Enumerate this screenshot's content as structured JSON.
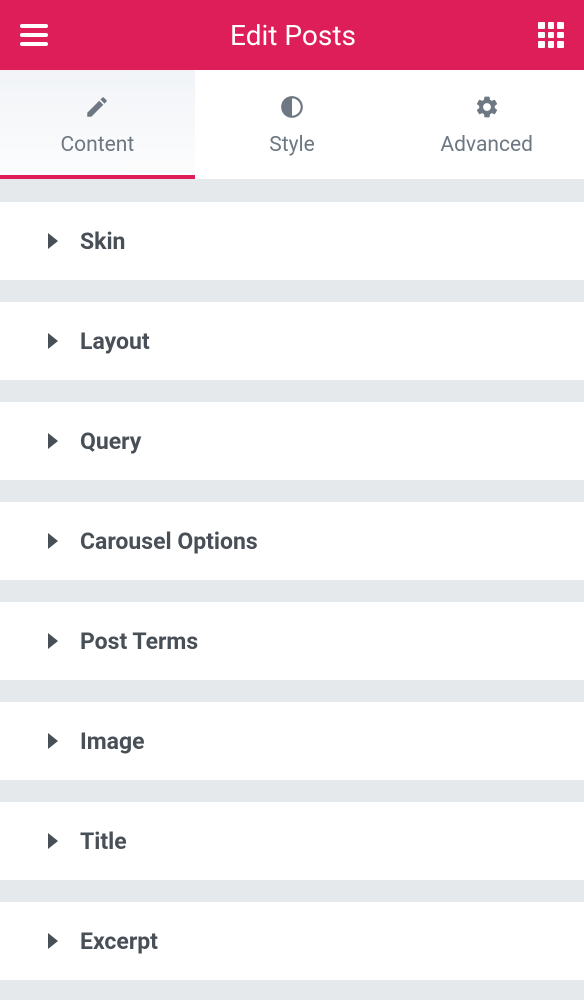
{
  "header": {
    "title": "Edit Posts"
  },
  "tabs": [
    {
      "label": "Content",
      "active": true,
      "icon": "pencil-icon"
    },
    {
      "label": "Style",
      "active": false,
      "icon": "contrast-icon"
    },
    {
      "label": "Advanced",
      "active": false,
      "icon": "gear-icon"
    }
  ],
  "sections": [
    {
      "title": "Skin"
    },
    {
      "title": "Layout"
    },
    {
      "title": "Query"
    },
    {
      "title": "Carousel Options"
    },
    {
      "title": "Post Terms"
    },
    {
      "title": "Image"
    },
    {
      "title": "Title"
    },
    {
      "title": "Excerpt"
    }
  ]
}
